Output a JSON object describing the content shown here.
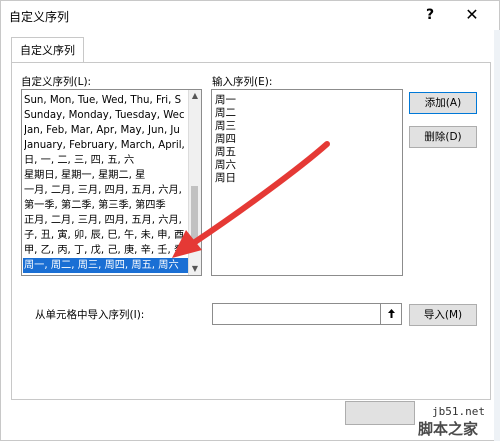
{
  "dialog": {
    "title": "自定义序列",
    "help_label": "?",
    "close_label": "✕"
  },
  "tabs": [
    {
      "label": "自定义序列",
      "active": true
    }
  ],
  "custom_lists": {
    "label": "自定义序列(L):",
    "items": [
      "Sun, Mon, Tue, Wed, Thu, Fri, S",
      "Sunday, Monday, Tuesday, Wec",
      "Jan, Feb, Mar, Apr, May, Jun, Ju",
      "January, February, March, April,",
      "日, 一, 二, 三, 四, 五, 六",
      "星期日, 星期一, 星期二, 星",
      "一月, 二月, 三月, 四月, 五月, 六月,",
      "第一季, 第二季, 第三季, 第四季",
      "正月, 二月, 三月, 四月, 五月, 六月,",
      "子, 丑, 寅, 卯, 辰, 巳, 午, 未, 申, 酉",
      "甲, 乙, 丙, 丁, 戊, 己, 庚, 辛, 壬, 癸",
      "周一, 周二, 周三, 周四, 周五, 周六"
    ],
    "selected_index": 11
  },
  "entries": {
    "label": "输入序列(E):",
    "lines": [
      "周一",
      "周二",
      "周三",
      "周四",
      "周五",
      "周六",
      "周日"
    ]
  },
  "buttons": {
    "add": "添加(A)",
    "delete": "删除(D)",
    "import": "导入(M)"
  },
  "import_row": {
    "label": "从单元格中导入序列(I):",
    "value": "",
    "picker_icon": "collapse-arrow-icon"
  },
  "watermark": {
    "site": "jb51.net",
    "brand": "脚本之家"
  },
  "colors": {
    "selection": "#1a6fd4",
    "annotation_arrow": "#e53935",
    "primary_button_border": "#0078d7"
  }
}
